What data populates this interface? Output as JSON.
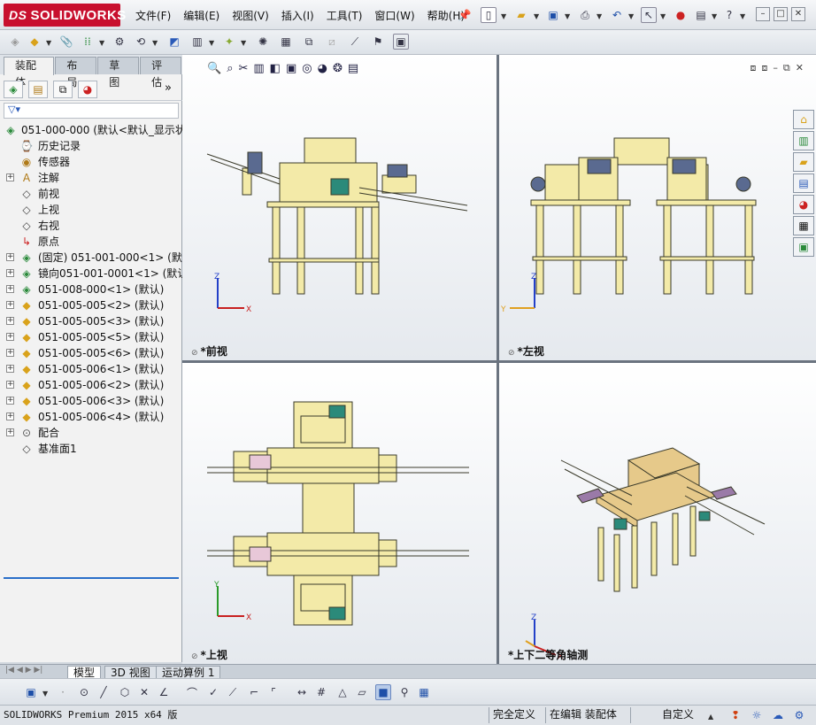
{
  "app": {
    "logo_text": "SOLIDWORKS",
    "logo_prefix": "DS"
  },
  "menu": [
    "文件(F)",
    "编辑(E)",
    "视图(V)",
    "插入(I)",
    "工具(T)",
    "窗口(W)",
    "帮助(H)"
  ],
  "command_tabs": [
    "装配体",
    "布局",
    "草图",
    "评估"
  ],
  "tree": {
    "root": "051-000-000    (默认<默认_显示状",
    "items": [
      {
        "label": "历史记录",
        "icon": "history-icon",
        "expand": false
      },
      {
        "label": "传感器",
        "icon": "sensor-icon",
        "expand": false
      },
      {
        "label": "注解",
        "icon": "annotation-icon",
        "expand": true
      },
      {
        "label": "前视",
        "icon": "plane-icon",
        "expand": false
      },
      {
        "label": "上视",
        "icon": "plane-icon",
        "expand": false
      },
      {
        "label": "右视",
        "icon": "plane-icon",
        "expand": false
      },
      {
        "label": "原点",
        "icon": "origin-icon",
        "expand": false
      },
      {
        "label": "(固定) 051-001-000<1> (默认",
        "icon": "component-icon",
        "expand": true
      },
      {
        "label": "镜向051-001-0001<1> (默认)",
        "icon": "component-icon",
        "expand": true
      },
      {
        "label": "051-008-000<1> (默认)",
        "icon": "component-icon",
        "expand": true
      },
      {
        "label": "051-005-005<2> (默认)",
        "icon": "part-icon",
        "expand": true
      },
      {
        "label": "051-005-005<3> (默认)",
        "icon": "part-icon",
        "expand": true
      },
      {
        "label": "051-005-005<5> (默认)",
        "icon": "part-icon",
        "expand": true
      },
      {
        "label": "051-005-005<6> (默认)",
        "icon": "part-icon",
        "expand": true
      },
      {
        "label": "051-005-006<1> (默认)",
        "icon": "part-icon",
        "expand": true
      },
      {
        "label": "051-005-006<2> (默认)",
        "icon": "part-icon",
        "expand": true
      },
      {
        "label": "051-005-006<3> (默认)",
        "icon": "part-icon",
        "expand": true
      },
      {
        "label": "051-005-006<4> (默认)",
        "icon": "part-icon",
        "expand": true
      },
      {
        "label": "配合",
        "icon": "mates-icon",
        "expand": true
      },
      {
        "label": "基准面1",
        "icon": "plane-icon",
        "expand": false
      }
    ]
  },
  "viewports": {
    "front": "*前视",
    "left": "*左视",
    "top": "*上视",
    "iso": "*上下二等角轴测"
  },
  "axes": {
    "x": "X",
    "y": "Y",
    "z": "Z"
  },
  "bottom_tabs": [
    "模型",
    "3D 视图",
    "运动算例 1"
  ],
  "status": {
    "version": "SOLIDWORKS Premium 2015 x64 版",
    "defined": "完全定义",
    "editing": "在编辑 装配体",
    "custom": "自定义"
  },
  "colors": {
    "frame": "#f3eaa8",
    "frame_stroke": "#3a3a2a",
    "accent": "#c8102e",
    "motor": "#2b8a7a"
  }
}
